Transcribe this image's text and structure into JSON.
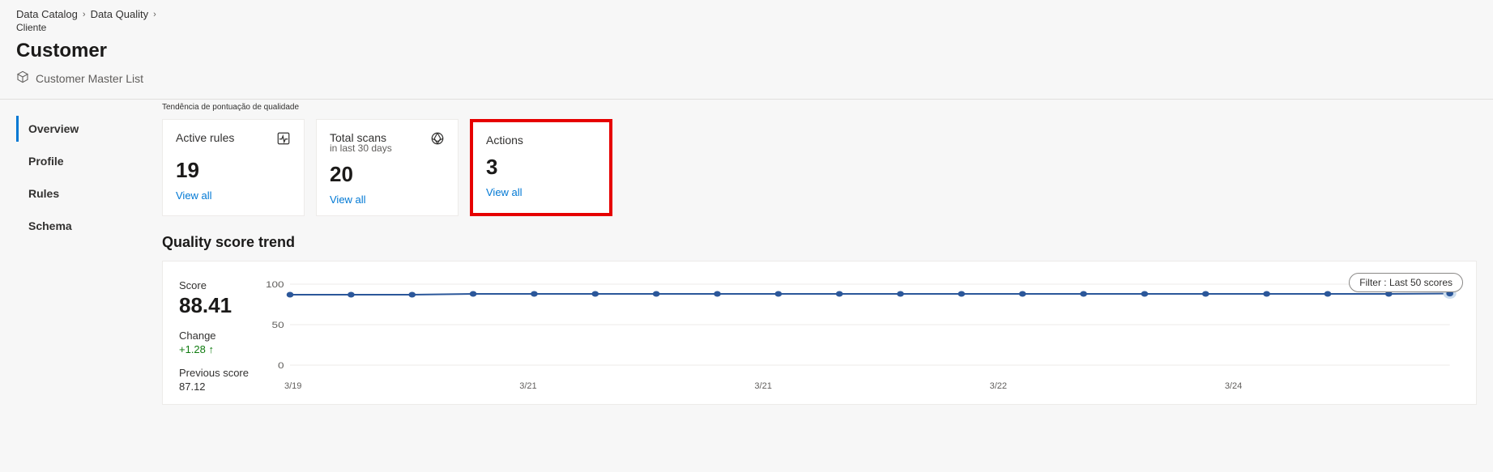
{
  "breadcrumb": {
    "items": [
      "Data Catalog",
      "Data Quality"
    ],
    "sub": "Cliente"
  },
  "page": {
    "title": "Customer",
    "subtitle": "Customer Master List"
  },
  "annotation": "Tendência de pontuação de qualidade",
  "sidebar": {
    "items": [
      {
        "label": "Overview",
        "active": true
      },
      {
        "label": "Profile",
        "active": false
      },
      {
        "label": "Rules",
        "active": false
      },
      {
        "label": "Schema",
        "active": false
      }
    ]
  },
  "cards": [
    {
      "title": "Active rules",
      "sub": "",
      "value": "19",
      "link": "View all",
      "icon": "heartbeat",
      "highlight": false
    },
    {
      "title": "Total scans",
      "sub": "in last 30 days",
      "value": "20",
      "link": "View all",
      "icon": "aperture",
      "highlight": false
    },
    {
      "title": "Actions",
      "sub": "",
      "value": "3",
      "link": "View all",
      "icon": "",
      "highlight": true
    }
  ],
  "trend": {
    "title": "Quality score trend",
    "score_label": "Score",
    "score_value": "88.41",
    "change_label": "Change",
    "change_value": "+1.28 ↑",
    "prev_label": "Previous score",
    "prev_value": "87.12",
    "filter_label": "Filter : Last 50 scores"
  },
  "chart_data": {
    "type": "line",
    "ylabel": "",
    "xlabel": "",
    "ylim": [
      0,
      100
    ],
    "yticks": [
      100,
      50,
      0
    ],
    "xticks": [
      "3/19",
      "3/21",
      "3/21",
      "3/22",
      "3/24"
    ],
    "series": [
      {
        "name": "Quality score",
        "values": [
          87,
          87,
          87,
          88,
          88,
          88,
          88,
          88,
          88,
          88,
          88,
          88,
          88,
          88,
          88,
          88,
          88,
          88,
          88,
          88.41
        ]
      }
    ]
  }
}
